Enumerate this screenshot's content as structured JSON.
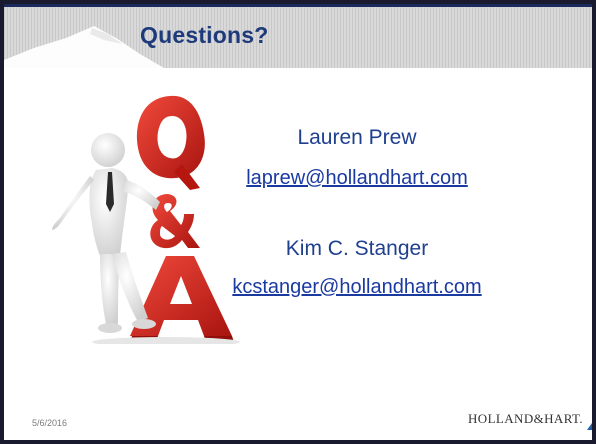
{
  "slide": {
    "title": "Questions?",
    "contacts": [
      {
        "name": "Lauren Prew",
        "email": "laprew@hollandhart.com"
      },
      {
        "name": "Kim C. Stanger",
        "email": "kcstanger@hollandhart.com"
      }
    ],
    "date": "5/6/2016",
    "logo_text": "HOLLAND&HART.",
    "illustration": {
      "icon": "qa-figure-icon",
      "letters": [
        "Q",
        "&",
        "A"
      ]
    }
  },
  "colors": {
    "title": "#1e3a7a",
    "link": "#1a3aa0",
    "qa_red": "#d9221c",
    "logo_blue": "#1f5fa8"
  }
}
